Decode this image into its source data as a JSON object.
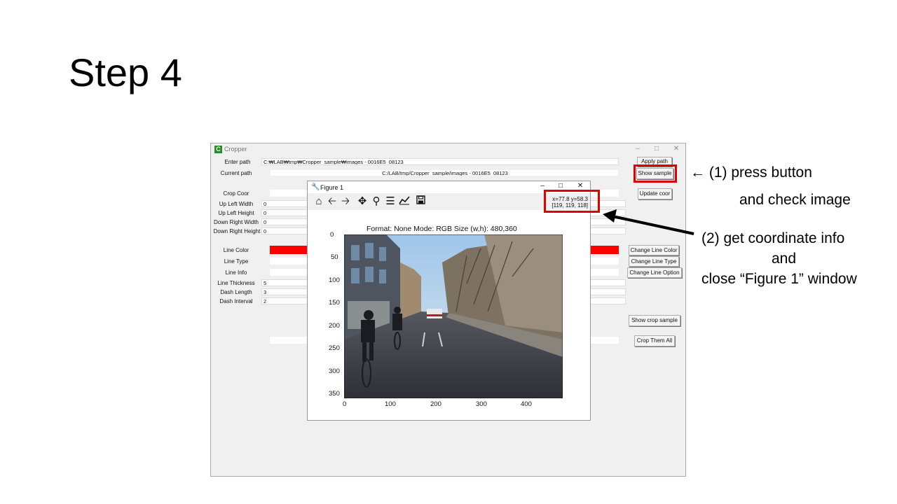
{
  "slide": {
    "title": "Step 4",
    "annotation_1_line1": "← (1) press button",
    "annotation_1_line2": "and check image",
    "annotation_2_line1": "(2) get coordinate info",
    "annotation_2_line2": "and",
    "annotation_2_line3": "close “Figure 1” window"
  },
  "cropper": {
    "title": "Cropper",
    "icon_letter": "C",
    "labels": {
      "enter_path": "Enter path",
      "current_path": "Current path",
      "crop_coor": "Crop Coor",
      "up_left_width": "Up Left Width",
      "up_left_height": "Up Left Height",
      "down_right_width": "Down Right Width",
      "down_right_height": "Down Right Height",
      "line_color": "Line Color",
      "line_type": "Line Type",
      "line_info": "Line Info",
      "line_thickness": "Line Thickness",
      "dash_length": "Dash Length",
      "dash_interval": "Dash Interval"
    },
    "values": {
      "enter_path": "C:₩LAB₩tmp₩Cropper_sample₩images - 0016E5_08123",
      "current_path": "C:/LAB/tmp/Cropper_sample/images - 0016E5_08123",
      "up_left_width": "0",
      "up_left_height": "0",
      "down_right_width": "0",
      "down_right_height": "0",
      "line_thickness": "5",
      "dash_length": "3",
      "dash_interval": "2"
    },
    "buttons": {
      "apply_path": "Apply path",
      "show_sample": "Show sample",
      "update_coor": "Update coor",
      "change_line_color": "Change Line Color",
      "change_line_type": "Change Line Type",
      "change_line_option": "Change Line Option",
      "show_crop_sample": "Show crop sample",
      "crop_them_all": "Crop Them All"
    },
    "colors": {
      "line_color": "#ff0000",
      "highlight": "#e00000"
    }
  },
  "figure": {
    "title": "Figure 1",
    "toolbar_icons": [
      "home-icon",
      "back-arrow-icon",
      "forward-arrow-icon",
      "pan-icon",
      "zoom-icon",
      "configure-subplots-icon",
      "edit-axis-icon",
      "save-icon"
    ],
    "coord_line1": "x=77.8 y=58.3",
    "coord_line2": "[119, 119, 118]",
    "plot_title": "Format: None  Mode: RGB  Size (w,h): 480,360",
    "x_ticks": [
      "0",
      "100",
      "200",
      "300",
      "400"
    ],
    "y_ticks": [
      "0",
      "50",
      "100",
      "150",
      "200",
      "250",
      "300",
      "350"
    ]
  }
}
